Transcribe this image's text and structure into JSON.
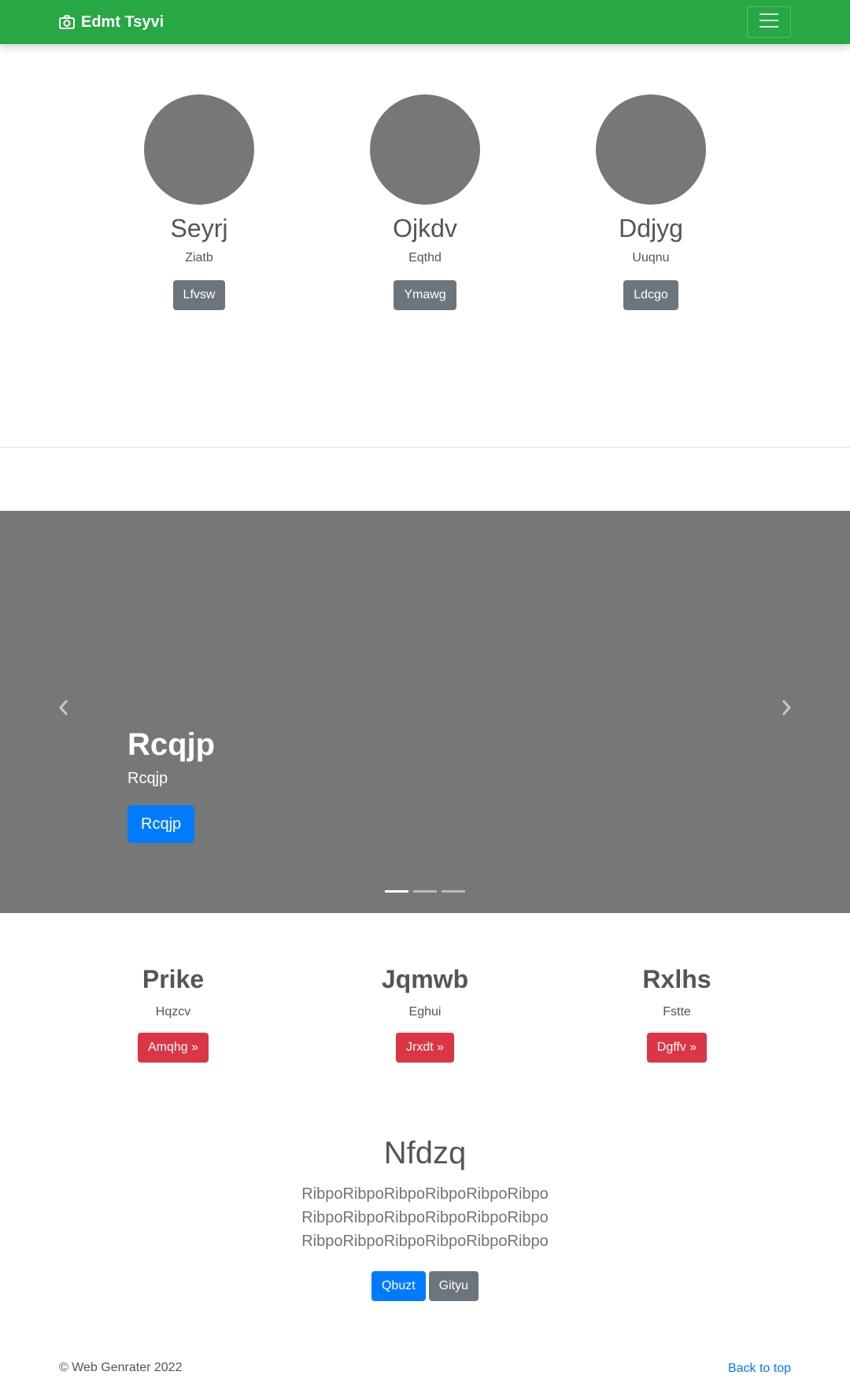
{
  "navbar": {
    "brand": "Edmt Tsyvi",
    "brand_icon": "camera-icon",
    "toggler_icon": "hamburger-icon",
    "color": "#28a745"
  },
  "avatars": [
    {
      "name": "Seyrj",
      "subtitle": "Ziatb",
      "button": "Lfvsw"
    },
    {
      "name": "Ojkdv",
      "subtitle": "Eqthd",
      "button": "Ymawg"
    },
    {
      "name": "Ddjyg",
      "subtitle": "Uuqnu",
      "button": "Ldcgo"
    }
  ],
  "carousel": {
    "title": "Rcqjp",
    "text": "Rcqjp",
    "button": "Rcqjp",
    "prev_icon": "chevron-left-icon",
    "next_icon": "chevron-right-icon",
    "slide_count": 3,
    "active_slide": 1
  },
  "features": [
    {
      "title": "Prike",
      "subtitle": "Hqzcv",
      "button": "Amqhg »"
    },
    {
      "title": "Jqmwb",
      "subtitle": "Eghui",
      "button": "Jrxdt »"
    },
    {
      "title": "Rxlhs",
      "subtitle": "Fstte",
      "button": "Dgffv »"
    }
  ],
  "hero": {
    "title": "Nfdzq",
    "lead": "RibpoRibpoRibpoRibpoRibpoRibpo RibpoRibpoRibpoRibpoRibpoRibpo RibpoRibpoRibpoRibpoRibpoRibpo",
    "primary_button": "Qbuzt",
    "secondary_button": "Gityu"
  },
  "footer": {
    "copyright": "© Web Genrater 2022",
    "back_to_top": "Back to top"
  }
}
